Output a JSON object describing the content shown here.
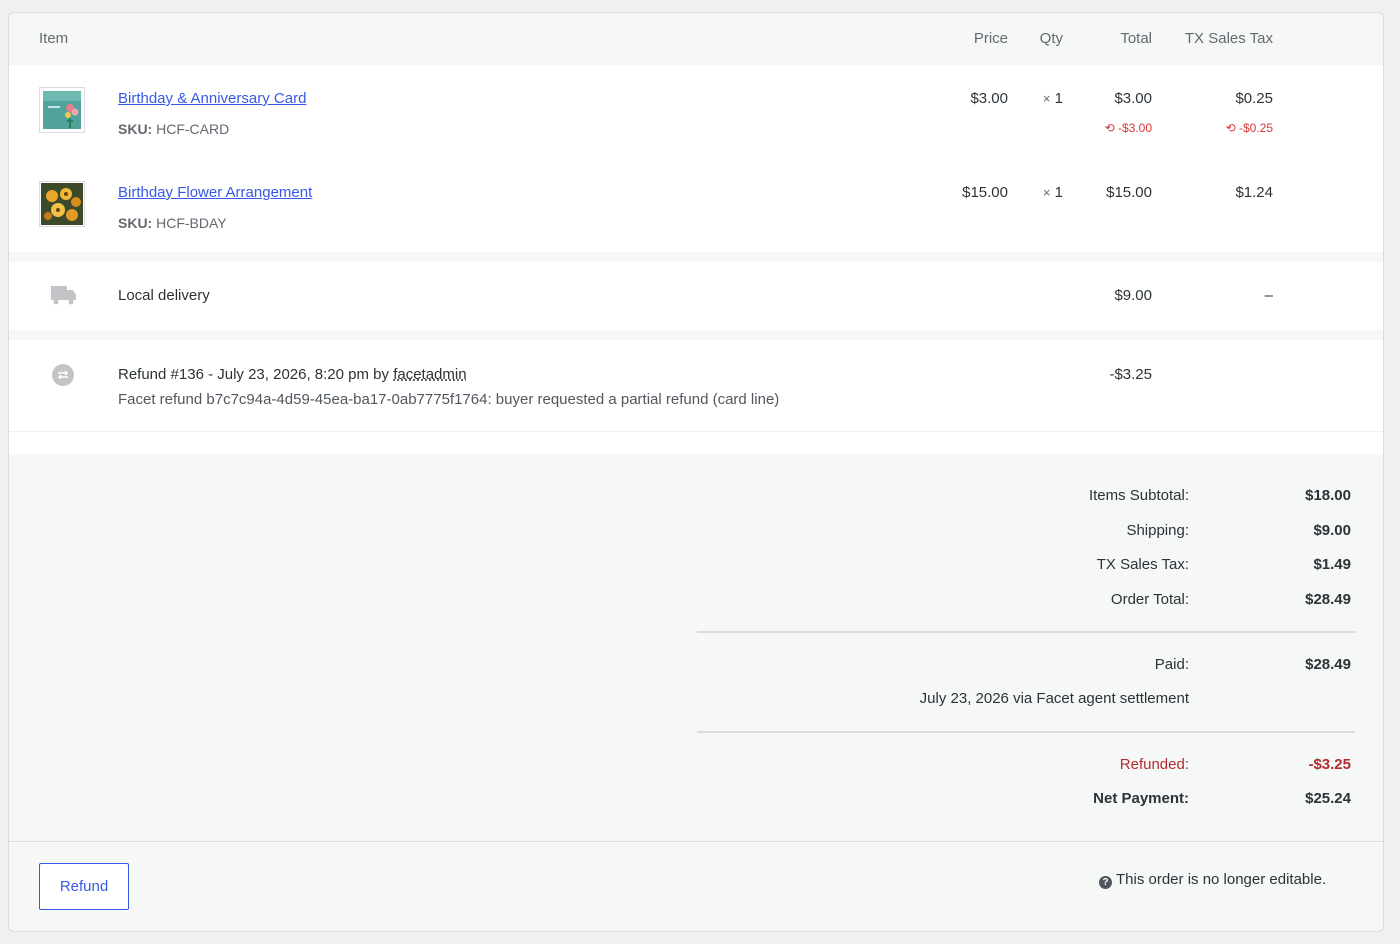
{
  "header": {
    "item": "Item",
    "price": "Price",
    "qty": "Qty",
    "total": "Total",
    "tax": "TX Sales Tax"
  },
  "items": [
    {
      "name": "Birthday & Anniversary Card",
      "sku_label": "SKU:",
      "sku": "HCF-CARD",
      "price": "$3.00",
      "qty_mult": "×",
      "qty": "1",
      "total": "$3.00",
      "tax": "$0.25",
      "total_refunded": "-$3.00",
      "tax_refunded": "-$0.25",
      "thumb_icon": "greeting-card-thumbnail"
    },
    {
      "name": "Birthday Flower Arrangement",
      "sku_label": "SKU:",
      "sku": "HCF-BDAY",
      "price": "$15.00",
      "qty_mult": "×",
      "qty": "1",
      "total": "$15.00",
      "tax": "$1.24",
      "thumb_icon": "flower-arrangement-thumbnail"
    }
  ],
  "shipping": {
    "name": "Local delivery",
    "total": "$9.00",
    "tax": "–",
    "icon": "truck-icon"
  },
  "refund": {
    "title_prefix": "Refund #136 - July 23, 2026, 8:20 pm by",
    "by_user": "facetadmin",
    "reason": "Facet refund b7c7c94a-4d59-45ea-ba17-0ab7775f1764: buyer requested a partial refund (card line)",
    "amount": "-$3.25",
    "icon": "refund-icon"
  },
  "totals": {
    "items_subtotal_label": "Items Subtotal:",
    "items_subtotal": "$18.00",
    "shipping_label": "Shipping:",
    "shipping": "$9.00",
    "tax_label": "TX Sales Tax:",
    "tax": "$1.49",
    "order_total_label": "Order Total:",
    "order_total": "$28.49",
    "paid_label": "Paid:",
    "paid": "$28.49",
    "paid_note": "July 23, 2026 via Facet agent settlement",
    "refunded_label": "Refunded:",
    "refunded": "-$3.25",
    "net_label": "Net Payment:",
    "net": "$25.24"
  },
  "footer": {
    "refund_button": "Refund",
    "not_editable": "This order is no longer editable.",
    "help_icon": "help-icon"
  },
  "colors": {
    "link": "#3858e9",
    "refund_red": "#d63638",
    "refunded_total_red": "#b32d2e"
  }
}
